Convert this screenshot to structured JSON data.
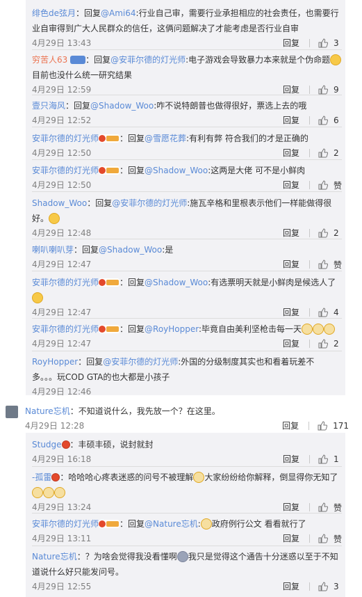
{
  "upper_replies": [
    {
      "user": "绯色de弦月",
      "text_parts": [
        "：回复",
        "@Ami64",
        ":行业自己审，需要行业承担相应的社会责任，也需要行"
      ],
      "line2": "业自审得到广大人民群众的信任，这俩问题解决了才能考虑是否行业自审",
      "time": "4月29日 13:43",
      "reply": "回复",
      "likes": "3"
    },
    {
      "user": "穷苦人63",
      "badge": "vip",
      "text_parts": [
        "：回复",
        "@安菲尔德的灯光师",
        ":电子游戏会导致暴力本来就是个伪命题"
      ],
      "line2": "目前也没什么统一研究结果",
      "time": "4月29日 12:59",
      "reply": "回复",
      "likes": "9"
    },
    {
      "user": "壹只海风",
      "text_parts": [
        "：回复",
        "@Shadow_Woo",
        ":咋不说特朗普也做得很好，票选上去的哦"
      ],
      "time": "4月29日 12:52",
      "reply": "回复",
      "likes": "6"
    },
    {
      "user": "安菲尔德的灯光师",
      "badge": "fan",
      "text_parts": [
        "：回复",
        "@雪愿花葬",
        ":有利有弊 符合我们的才是正确的"
      ],
      "time": "4月29日 12:50",
      "reply": "回复",
      "likes": "2"
    },
    {
      "user": "安菲尔德的灯光师",
      "badge": "fan",
      "text_parts": [
        "：回复",
        "@Shadow_Woo",
        ":这两是大佬 可不是小鲜肉"
      ],
      "time": "4月29日 12:50",
      "reply": "回复",
      "likes": "赞"
    },
    {
      "user": "Shadow_Woo",
      "text_parts": [
        "：回复",
        "@安菲尔德的灯光师",
        ":施瓦辛格和里根表示他们一样能做得很"
      ],
      "line2": "好。",
      "time": "4月29日 12:48",
      "reply": "回复",
      "likes": "2"
    },
    {
      "user": "喇叭喇叭芽",
      "text_parts": [
        "：回复",
        "@Shadow_Woo",
        ":是"
      ],
      "time": "4月29日 12:47",
      "reply": "回复",
      "likes": "赞"
    },
    {
      "user": "安菲尔德的灯光师",
      "badge": "fan",
      "text_parts": [
        "：回复",
        "@Shadow_Woo",
        ":有选票明天就是小鲜肉是候选人了"
      ],
      "time": "4月29日 12:47",
      "reply": "回复",
      "likes": "4"
    },
    {
      "user": "安菲尔德的灯光师",
      "badge": "fan",
      "text_parts": [
        "：回复",
        "@RoyHopper",
        ":毕竟自由美利坚枪击每一天"
      ],
      "time": "4月29日 12:47",
      "reply": "回复",
      "likes": "2"
    },
    {
      "user": "RoyHopper",
      "text_parts": [
        "：回复",
        "@安菲尔德的灯光师",
        ":外国的分级制度其实也和看着玩差不"
      ],
      "line2": "多。。。玩COD GTA的也大都是小孩子",
      "time": "4月29日 12:46",
      "reply": "",
      "likes": ""
    }
  ],
  "main_comment": {
    "user": "Nature忘机",
    "text": "：不知道说什么，我先放一个？在这里。",
    "time": "4月29日 12:28",
    "reply": "回复",
    "likes": "171"
  },
  "lower_replies": [
    {
      "user": "Studge",
      "text": "：丰硕丰硕，说封就封",
      "time": "4月29日 16:18",
      "reply": "回复",
      "likes": "1"
    },
    {
      "user": "-孤雷",
      "text": "：哈哈哈心疼表迷惑的问号不被理解",
      "text_b": "大家纷纷给你解释，倒显得你无知了",
      "time": "4月29日 13:24",
      "reply": "回复",
      "likes": "赞"
    },
    {
      "user": "安菲尔德的灯光师",
      "text_parts": [
        "：回复",
        "@Nature忘机",
        ":"
      ],
      "text_b": "政府例行公文 看看就行了",
      "time": "4月29日 13:11",
      "reply": "回复",
      "likes": "赞"
    },
    {
      "user": "Nature忘机",
      "text": "：？为啥会觉得我没看懂啊",
      "text_b": "我只是觉得这个通告十分迷惑以至于不知",
      "line2": "道说什么好只能发问号。",
      "time": "4月29日 12:55",
      "reply": "回复",
      "likes": "3"
    }
  ]
}
